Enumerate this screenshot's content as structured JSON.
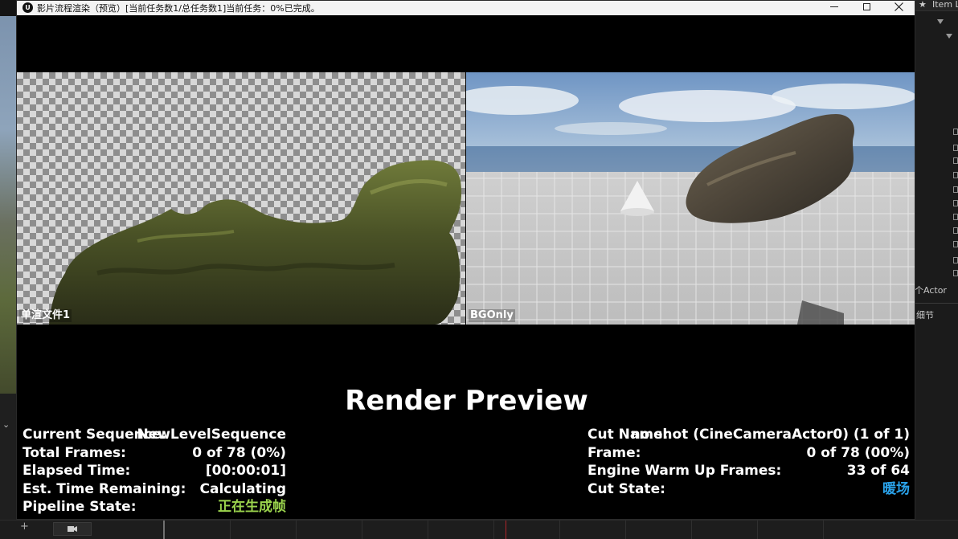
{
  "window": {
    "title": "影片流程渲染（预览）[当前任务数1/总任务数1]当前任务：0%已完成。",
    "logo": "U"
  },
  "background_editor": {
    "panel_tab_label": "Item L",
    "actor_label": "个Actor",
    "details_label": "细节"
  },
  "panes": [
    {
      "label": "单渲文件1",
      "checkerboard": true
    },
    {
      "label": "BGOnly",
      "checkerboard": false
    }
  ],
  "render_preview": {
    "title": "Render Preview",
    "left_stats": [
      {
        "label": "Current Sequence:",
        "value": "NewLevelSequence"
      },
      {
        "label": "Total Frames:",
        "value": "0 of 78 (0%)"
      },
      {
        "label": "Elapsed Time:",
        "value": "[00:00:01]"
      },
      {
        "label": "Est. Time Remaining:",
        "value": "Calculating"
      },
      {
        "label": "Pipeline State:",
        "value": "正在生成帧"
      }
    ],
    "right_stats": [
      {
        "label": "Cut Name:",
        "value": "no shot (CineCameraActor0) (1 of 1)"
      },
      {
        "label": "Frame:",
        "value": "0 of 78 (00%)"
      },
      {
        "label": "Engine Warm Up Frames:",
        "value": "33 of 64"
      },
      {
        "label": "Cut State:",
        "value": "暖场"
      }
    ]
  },
  "colors": {
    "pipeline_state": "#9bd44d",
    "cut_state": "#2aa2ea",
    "playhead": "#b0242a"
  }
}
